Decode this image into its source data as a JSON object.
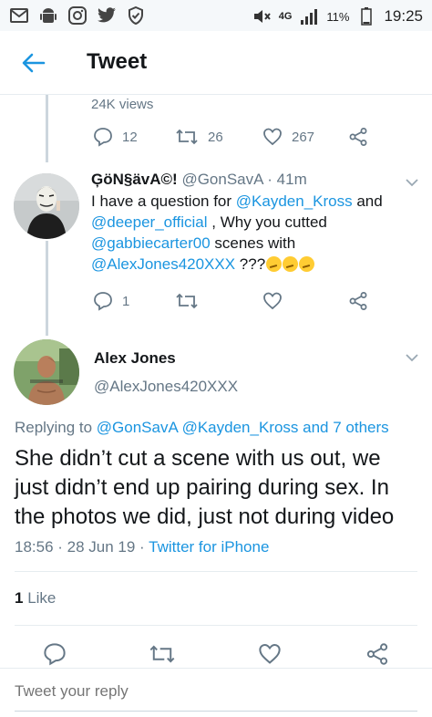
{
  "status_bar": {
    "network": "4G",
    "battery": "11%",
    "time": "19:25",
    "icons": [
      "mail-icon",
      "android-icon",
      "instagram-icon",
      "twitter-icon",
      "shield-icon",
      "mute-icon",
      "signal-icon",
      "battery-icon"
    ]
  },
  "header": {
    "title": "Tweet"
  },
  "parent_tweet": {
    "views": "24K views",
    "replies": "12",
    "retweets": "26",
    "likes": "267"
  },
  "reply_tweet": {
    "display_name": "ĢöN§ävA©!",
    "handle": "@GonSavA",
    "time": "· 41m",
    "text_parts": {
      "p1": "I have a question for ",
      "m1": "@Kayden_Kross",
      "p2": " and ",
      "m2": "@deeper_official",
      "p3": " , Why you cutted ",
      "m3": "@gabbiecarter00",
      "p4": " scenes with ",
      "m4": "@AlexJones420XXX",
      "p5": " ???"
    },
    "replies": "1"
  },
  "main_tweet": {
    "display_name": "Alex Jones",
    "handle": "@AlexJones420XXX",
    "replying_label": "Replying to ",
    "replying_to": "@GonSavA @Kayden_Kross and 7 others",
    "text": "She didn’t cut a scene with us out, we just didn’t end up pairing during sex. In the photos we did, just not during video",
    "timestamp": "18:56 · 28 Jun 19 · ",
    "source": "Twitter for iPhone",
    "like_count": "1",
    "like_label": " Like"
  },
  "compose": {
    "placeholder": "Tweet your reply"
  },
  "colors": {
    "accent": "#1b95e0",
    "muted": "#657786",
    "text": "#14171a"
  }
}
